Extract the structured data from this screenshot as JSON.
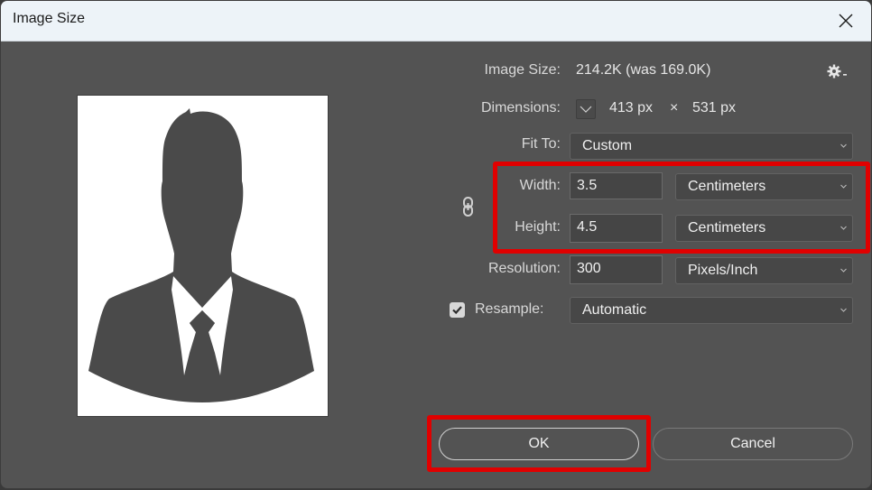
{
  "window": {
    "title": "Image Size"
  },
  "info": {
    "image_size_label": "Image Size:",
    "image_size_value": "214.2K (was 169.0K)",
    "dimensions_label": "Dimensions:",
    "dimensions_width": "413 px",
    "dimensions_times": "×",
    "dimensions_height": "531 px"
  },
  "fit_to": {
    "label": "Fit To:",
    "value": "Custom"
  },
  "width": {
    "label": "Width:",
    "value": "3.5",
    "unit": "Centimeters"
  },
  "height": {
    "label": "Height:",
    "value": "4.5",
    "unit": "Centimeters"
  },
  "resolution": {
    "label": "Resolution:",
    "value": "300",
    "unit": "Pixels/Inch"
  },
  "resample": {
    "label": "Resample:",
    "checked": true,
    "value": "Automatic"
  },
  "buttons": {
    "ok": "OK",
    "cancel": "Cancel"
  },
  "colors": {
    "highlight": "#e00000",
    "panel": "#535353",
    "titlebar": "#edf3f8"
  }
}
